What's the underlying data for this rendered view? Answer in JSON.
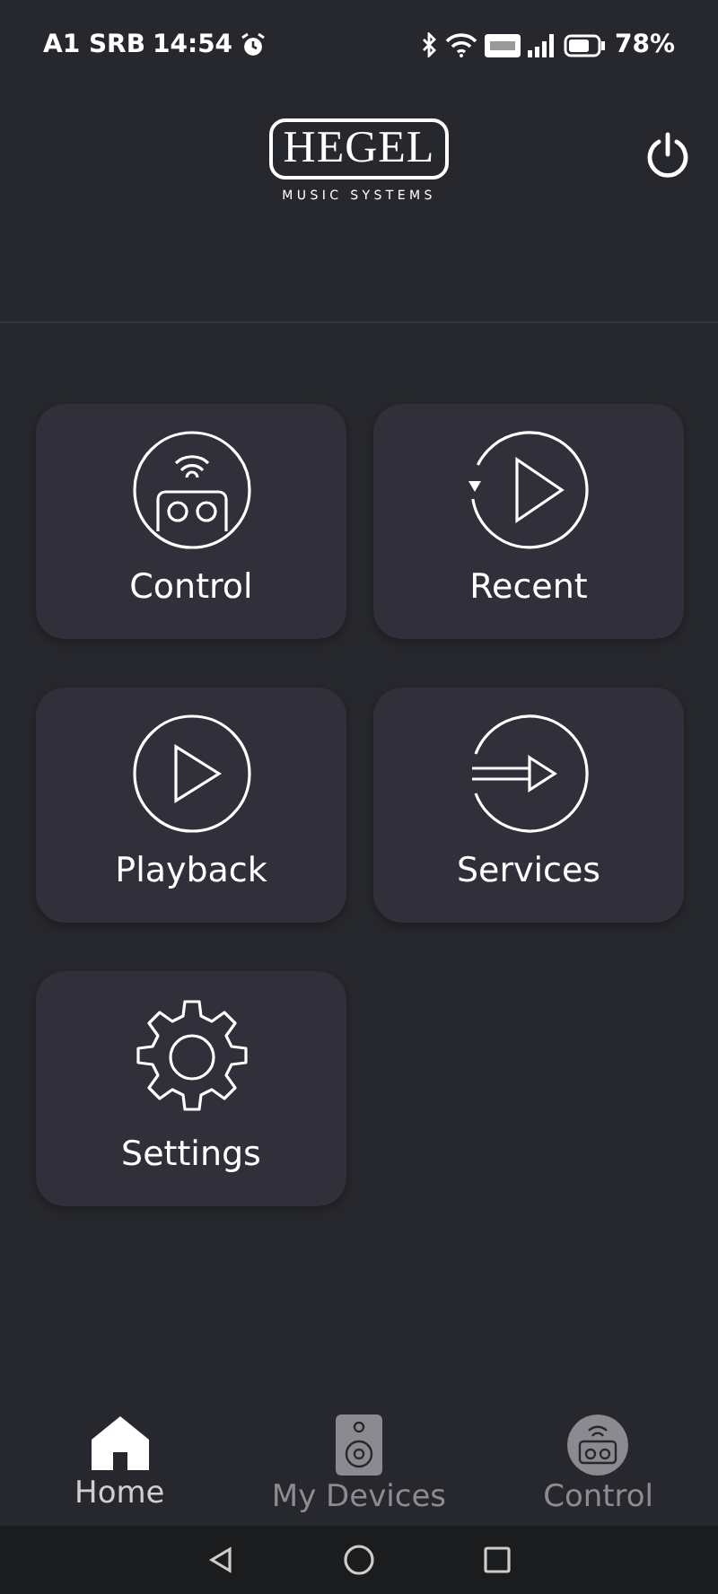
{
  "status_bar": {
    "carrier": "A1 SRB",
    "time": "14:54",
    "battery": "78%"
  },
  "header": {
    "logo": "HEGEL",
    "logo_subtitle": "MUSIC SYSTEMS"
  },
  "tiles": [
    {
      "label": "Control",
      "kind": "control"
    },
    {
      "label": "Recent",
      "kind": "recent"
    },
    {
      "label": "Playback",
      "kind": "playback"
    },
    {
      "label": "Services",
      "kind": "services"
    },
    {
      "label": "Settings",
      "kind": "settings"
    }
  ],
  "bottom_nav": [
    {
      "label": "Home",
      "kind": "home",
      "selected": true
    },
    {
      "label": "My Devices",
      "kind": "devices",
      "selected": false
    },
    {
      "label": "Control",
      "kind": "control",
      "selected": false
    }
  ]
}
